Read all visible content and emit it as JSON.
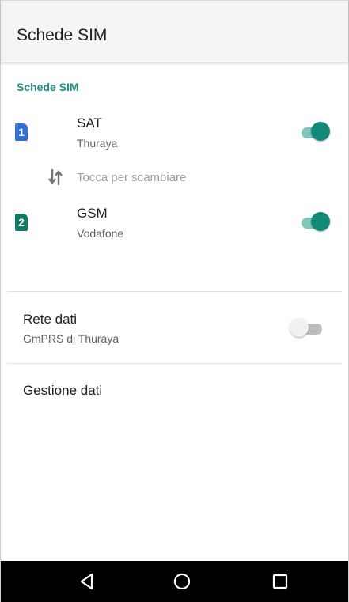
{
  "appbar": {
    "title": "Schede SIM"
  },
  "sims_section": {
    "header": "Schede SIM",
    "sims": [
      {
        "slot_number": "1",
        "name": "SAT",
        "operator": "Thuraya",
        "enabled": true,
        "icon_color": "#2f6fd8"
      },
      {
        "slot_number": "2",
        "name": "GSM",
        "operator": "Vodafone",
        "enabled": true,
        "icon_color": "#0f7b62"
      }
    ],
    "swap": {
      "icon": "swap-vertical-arrows-icon",
      "label": "Tocca per scambiare"
    }
  },
  "data_network": {
    "title": "Rete dati",
    "subtitle": "GmPRS di Thuraya",
    "enabled": false
  },
  "data_management": {
    "title": "Gestione dati"
  },
  "navbar": {
    "back": "back-triangle-icon",
    "home": "home-circle-icon",
    "recents": "recents-square-icon"
  },
  "colors": {
    "accent": "#13897a",
    "section_header": "#1e8f81",
    "navbar": "#000000"
  }
}
